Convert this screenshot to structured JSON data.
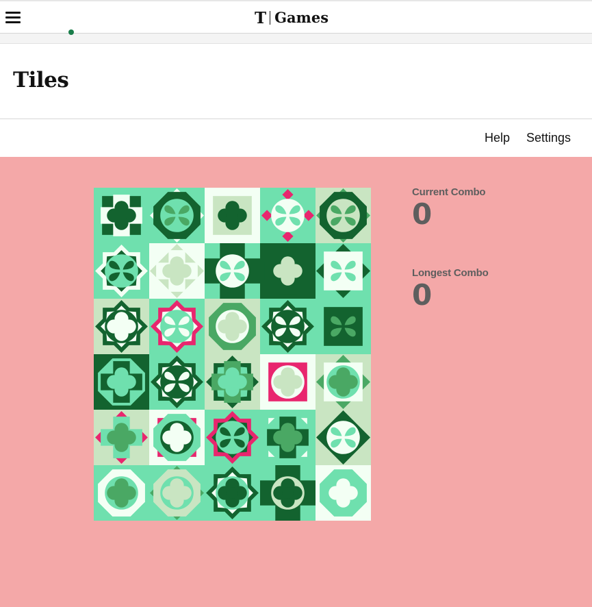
{
  "header": {
    "brand_mark": "T",
    "brand_name": "Games",
    "menu_icon": "hamburger-icon"
  },
  "page": {
    "title": "Tiles"
  },
  "toolbar": {
    "help_label": "Help",
    "settings_label": "Settings"
  },
  "stats": {
    "current_label": "Current Combo",
    "current_value": "0",
    "longest_label": "Longest Combo",
    "longest_value": "0"
  },
  "colors": {
    "background": "#f4a8a8",
    "dark_green": "#13632f",
    "mid_green": "#4aa864",
    "mint": "#6fe0ae",
    "pale": "#c9e5c2",
    "white": "#f3fff4",
    "pink": "#e8266e"
  },
  "board": {
    "columns": 5,
    "rows": 6,
    "tiles": [
      {
        "bg": "mint",
        "layers": [
          [
            "square",
            "dark"
          ],
          [
            "cross",
            "white"
          ],
          [
            "flower",
            "dark"
          ]
        ]
      },
      {
        "bg": "mint",
        "layers": [
          [
            "diamond",
            "white"
          ],
          [
            "octagon",
            "dark"
          ],
          [
            "circle",
            "mint"
          ],
          [
            "butterfly",
            "mid"
          ]
        ]
      },
      {
        "bg": "white",
        "layers": [
          [
            "square",
            "pale"
          ],
          [
            "flower",
            "dark"
          ]
        ]
      },
      {
        "bg": "mint",
        "layers": [
          [
            "points",
            "pink"
          ],
          [
            "circle",
            "white"
          ],
          [
            "butterfly",
            "mint"
          ]
        ]
      },
      {
        "bg": "pale",
        "layers": [
          [
            "diamond",
            "mid"
          ],
          [
            "octagon",
            "dark"
          ],
          [
            "circle",
            "pale"
          ],
          [
            "butterfly",
            "mid"
          ]
        ]
      },
      {
        "bg": "mint",
        "layers": [
          [
            "star",
            "white"
          ],
          [
            "starsm",
            "dark"
          ],
          [
            "circle",
            "mint"
          ],
          [
            "butterfly",
            "dark"
          ]
        ]
      },
      {
        "bg": "white",
        "layers": [
          [
            "diamond",
            "pale"
          ],
          [
            "cross",
            "white"
          ],
          [
            "flower",
            "pale"
          ]
        ]
      },
      {
        "bg": "mint",
        "layers": [
          [
            "bigcross",
            "dark"
          ],
          [
            "circle",
            "white"
          ],
          [
            "butterfly",
            "mint"
          ]
        ]
      },
      {
        "bg": "dark",
        "layers": [
          [
            "octagon",
            "dark"
          ],
          [
            "flower",
            "pale"
          ]
        ]
      },
      {
        "bg": "mint",
        "layers": [
          [
            "diamond",
            "dark"
          ],
          [
            "square",
            "white"
          ],
          [
            "butterfly",
            "mint"
          ]
        ]
      },
      {
        "bg": "pale",
        "layers": [
          [
            "star",
            "dark"
          ],
          [
            "starsm",
            "white"
          ],
          [
            "circle",
            "dark"
          ],
          [
            "flower",
            "white"
          ]
        ]
      },
      {
        "bg": "mint",
        "layers": [
          [
            "star",
            "pink"
          ],
          [
            "starsm",
            "white"
          ],
          [
            "circle",
            "mint"
          ],
          [
            "butterfly",
            "white"
          ]
        ]
      },
      {
        "bg": "pale",
        "layers": [
          [
            "octagon",
            "mid"
          ],
          [
            "circle",
            "white"
          ],
          [
            "flower",
            "pale"
          ]
        ]
      },
      {
        "bg": "mint",
        "layers": [
          [
            "star",
            "dark"
          ],
          [
            "starsm",
            "white"
          ],
          [
            "circle",
            "dark"
          ],
          [
            "butterfly",
            "white"
          ]
        ]
      },
      {
        "bg": "mint",
        "layers": [
          [
            "diamond",
            "mint"
          ],
          [
            "square",
            "dark"
          ],
          [
            "butterfly",
            "mid"
          ]
        ]
      },
      {
        "bg": "dark",
        "layers": [
          [
            "octagon",
            "mint"
          ],
          [
            "cross",
            "dark"
          ],
          [
            "flower",
            "mint"
          ]
        ]
      },
      {
        "bg": "mint",
        "layers": [
          [
            "star",
            "dark"
          ],
          [
            "starsm",
            "white"
          ],
          [
            "circle",
            "dark"
          ],
          [
            "butterfly",
            "white"
          ]
        ]
      },
      {
        "bg": "pale",
        "layers": [
          [
            "star",
            "dark"
          ],
          [
            "starsm",
            "mint"
          ],
          [
            "cross",
            "mid"
          ],
          [
            "flower",
            "mint"
          ]
        ]
      },
      {
        "bg": "white",
        "layers": [
          [
            "diamond",
            "white"
          ],
          [
            "square",
            "pink"
          ],
          [
            "circle",
            "white"
          ],
          [
            "flower",
            "pale"
          ]
        ]
      },
      {
        "bg": "pale",
        "layers": [
          [
            "diamond",
            "mid"
          ],
          [
            "square",
            "white"
          ],
          [
            "circle",
            "mint"
          ],
          [
            "flower",
            "mid"
          ]
        ]
      },
      {
        "bg": "pale",
        "layers": [
          [
            "points",
            "pink"
          ],
          [
            "cross",
            "mint"
          ],
          [
            "flower",
            "mid"
          ]
        ]
      },
      {
        "bg": "white",
        "layers": [
          [
            "square",
            "pink"
          ],
          [
            "octagon",
            "mint"
          ],
          [
            "circle",
            "dark"
          ],
          [
            "flower",
            "white"
          ]
        ]
      },
      {
        "bg": "mint",
        "layers": [
          [
            "star",
            "pink"
          ],
          [
            "starsm",
            "dark"
          ],
          [
            "circle",
            "mint"
          ],
          [
            "butterfly",
            "dark"
          ]
        ]
      },
      {
        "bg": "mint",
        "layers": [
          [
            "square",
            "white"
          ],
          [
            "octagon",
            "mint"
          ],
          [
            "cross",
            "dark"
          ],
          [
            "flower",
            "mid"
          ]
        ]
      },
      {
        "bg": "pale",
        "layers": [
          [
            "points",
            "dark"
          ],
          [
            "diamond",
            "dark"
          ],
          [
            "circle",
            "white"
          ],
          [
            "butterfly",
            "mint"
          ]
        ]
      },
      {
        "bg": "mint",
        "layers": [
          [
            "octagon",
            "white"
          ],
          [
            "circle",
            "mint"
          ],
          [
            "flower",
            "mid"
          ]
        ]
      },
      {
        "bg": "mint",
        "layers": [
          [
            "diamond",
            "mid"
          ],
          [
            "octagon",
            "pale"
          ],
          [
            "circle",
            "mint"
          ],
          [
            "flower",
            "pale"
          ]
        ]
      },
      {
        "bg": "mint",
        "layers": [
          [
            "star",
            "dark"
          ],
          [
            "starsm",
            "white"
          ],
          [
            "circle",
            "mint"
          ],
          [
            "flower",
            "dark"
          ]
        ]
      },
      {
        "bg": "mint",
        "layers": [
          [
            "bigcross",
            "dark"
          ],
          [
            "circle",
            "pale"
          ],
          [
            "flower",
            "dark"
          ]
        ]
      },
      {
        "bg": "white",
        "layers": [
          [
            "square",
            "white"
          ],
          [
            "octagon",
            "mint"
          ],
          [
            "flower",
            "white"
          ]
        ]
      }
    ]
  }
}
